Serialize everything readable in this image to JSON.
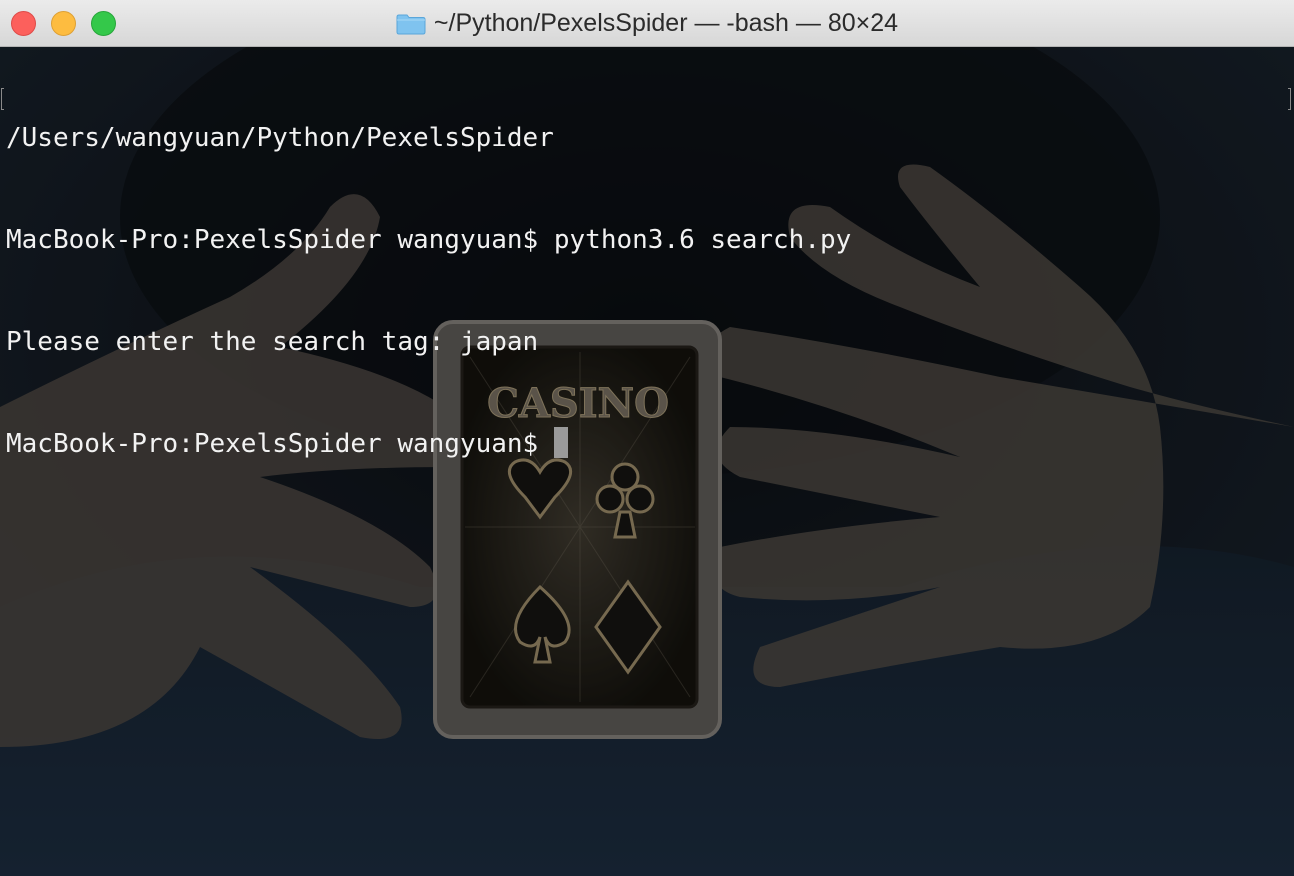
{
  "window": {
    "title": "~/Python/PexelsSpider — -bash — 80×24",
    "title_icon": "folder-icon"
  },
  "terminal": {
    "lines": [
      {
        "text": "/Users/wangyuan/Python/PexelsSpider"
      },
      {
        "text": "MacBook-Pro:PexelsSpider wangyuan$ python3.6 search.py"
      },
      {
        "text": "Please enter the search tag: japan"
      },
      {
        "text": "MacBook-Pro:PexelsSpider wangyuan$"
      }
    ]
  },
  "background_image": {
    "card_case_label": "CASINO"
  },
  "colors": {
    "close": "#fc605c",
    "minimize": "#fdbc40",
    "zoom": "#34c84a",
    "text": "#f2f2f2",
    "cursor": "#9a9a9a"
  }
}
